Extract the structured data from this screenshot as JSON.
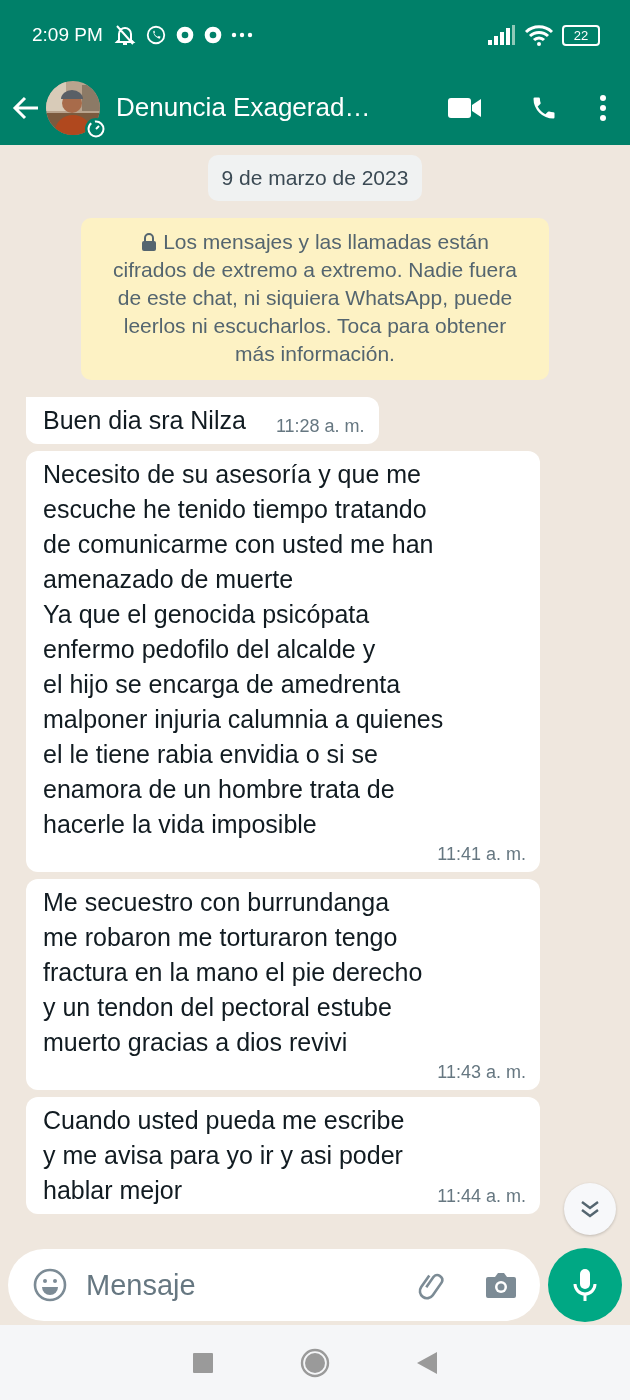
{
  "status_bar": {
    "time": "2:09 PM",
    "battery": "22"
  },
  "header": {
    "title": "Denuncia Exagerad…"
  },
  "date_chip": "9 de marzo de 2023",
  "encryption_notice": "Los mensajes y las llamadas están\ncifrados de extremo a extremo. Nadie fuera\nde este chat, ni siquiera WhatsApp, puede\nleerlos ni escucharlos. Toca para obtener\nmás información.",
  "messages": [
    {
      "text": "Buen dia sra Nilza",
      "time": "11:28 a. m.",
      "first": true
    },
    {
      "text": "Necesito de su asesoría y que me\nescuche he tenido tiempo tratando\nde comunicarme con usted me han\namenazado de muerte\nYa que el genocida psicópata\nenfermo pedofilo del alcalde y\nel hijo se encarga de amedrenta\nmalponer injuria calumnia a quienes\nel le tiene rabia envidia o si se\nenamora de un hombre trata de\nhacerle la vida imposible",
      "time": "11:41 a. m.",
      "first": false
    },
    {
      "text": "Me secuestro con burrundanga\nme robaron me torturaron tengo\nfractura en la mano el pie derecho\ny un tendon del pectoral estube\nmuerto gracias a dios revivi",
      "time": "11:43 a. m.",
      "first": false
    },
    {
      "text": "Cuando usted pueda me escribe\ny me avisa para yo ir y asi poder\nhablar mejor",
      "time": "11:44 a. m.",
      "first": false
    }
  ],
  "composer": {
    "placeholder": "Mensaje"
  }
}
